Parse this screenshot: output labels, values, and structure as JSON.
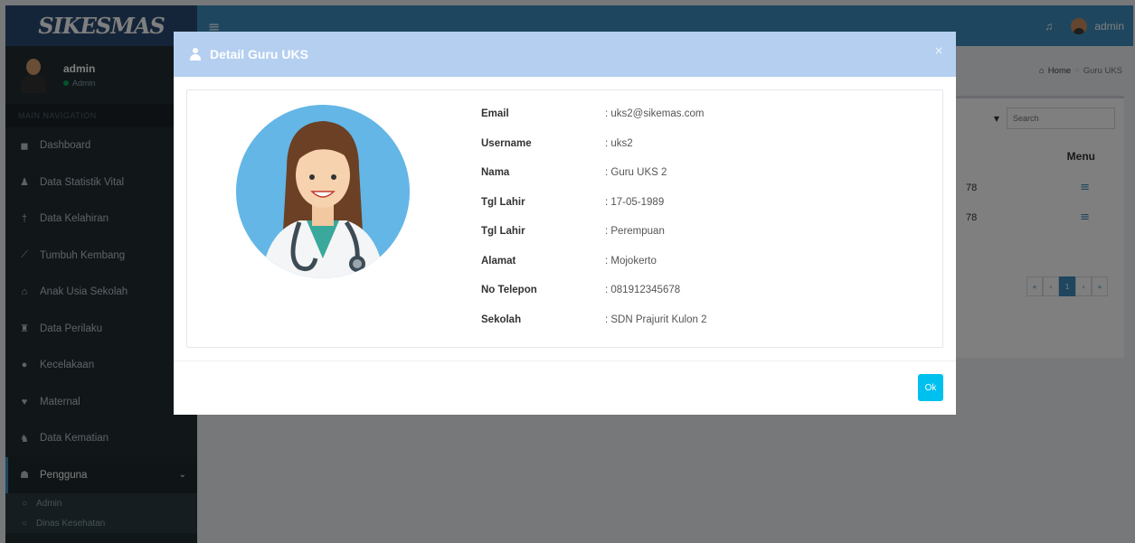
{
  "app": {
    "logo": "SIKESMAS"
  },
  "topbar": {
    "user_name": "admin"
  },
  "sidebar": {
    "user_name": "admin",
    "user_role": "Admin",
    "header": "MAIN NAVIGATION",
    "items": [
      {
        "label": "Dashboard",
        "icon": "dashboard-icon",
        "glyph": "◼"
      },
      {
        "label": "Data Statistik Vital",
        "icon": "user-icon",
        "glyph": "♟"
      },
      {
        "label": "Data Kelahiran",
        "icon": "child-icon",
        "glyph": "†"
      },
      {
        "label": "Tumbuh Kembang",
        "icon": "line-chart-icon",
        "glyph": "⟋"
      },
      {
        "label": "Anak Usia Sekolah",
        "icon": "graduation-cap-icon",
        "glyph": "⌂"
      },
      {
        "label": "Data Perilaku",
        "icon": "users-icon",
        "glyph": "♜"
      },
      {
        "label": "Kecelakaan",
        "icon": "alert-icon",
        "glyph": "●"
      },
      {
        "label": "Maternal",
        "icon": "heartbeat-icon",
        "glyph": "♥"
      },
      {
        "label": "Data Kematian",
        "icon": "group-icon",
        "glyph": "♞"
      },
      {
        "label": "Pengguna",
        "icon": "users-cog-icon",
        "glyph": "☗"
      }
    ],
    "sub_items": [
      {
        "label": "Admin"
      },
      {
        "label": "Dinas Kesehatan"
      }
    ]
  },
  "content": {
    "breadcrumb": {
      "home": "Home",
      "current": "Guru UKS"
    },
    "search_placeholder": "Search",
    "menu_header": "Menu",
    "row_fragments": [
      "78",
      "78"
    ],
    "pager": [
      "«",
      "‹",
      "1",
      "›",
      "»"
    ]
  },
  "modal": {
    "title": "Detail Guru UKS",
    "close": "×",
    "fields": [
      {
        "label": "Email",
        "value": ": uks2@sikemas.com"
      },
      {
        "label": "Username",
        "value": ": uks2"
      },
      {
        "label": "Nama",
        "value": ": Guru UKS 2"
      },
      {
        "label": "Tgl Lahir",
        "value": ": 17-05-1989"
      },
      {
        "label": "Tgl Lahir",
        "value": ": Perempuan"
      },
      {
        "label": "Alamat",
        "value": ": Mojokerto"
      },
      {
        "label": "No Telepon",
        "value": ": 081912345678"
      },
      {
        "label": "Sekolah",
        "value": ": SDN Prajurit Kulon 2"
      }
    ],
    "ok_label": "Ok"
  },
  "colors": {
    "topbar": "#3c8dbc",
    "logo_bg": "#2a4a72",
    "sidebar": "#222d32",
    "modal_header": "#b4cff0",
    "ok_button": "#00c0ef"
  }
}
